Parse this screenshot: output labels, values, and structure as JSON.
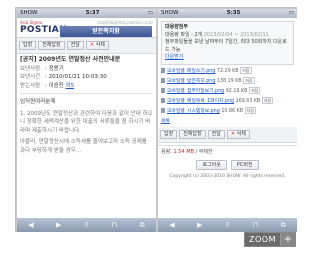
{
  "left": {
    "status": {
      "carrier": "SHOW",
      "time": "5:37"
    },
    "header": {
      "logo_small": "Asia Sigma",
      "logo_main": "POSTIAN",
      "email": "shom56@mbs.postian.co.kr",
      "title": "받은쪽지함"
    },
    "buttons": [
      "답장",
      "전체답장",
      "전달",
      "삭제"
    ],
    "message": {
      "subject": "[공지] 2009년도 연말정산 사전안내문",
      "from_label": "보낸사람",
      "from": "정용기",
      "date_label": "보낸시간",
      "date": "2010/01/21 10:03:30",
      "to_label": "받는사람",
      "to_prefix": "이승진",
      "to_link": "외5"
    },
    "body": [
      "임직원여러분께",
      "1. 2009년도 연말정산과 관련하여 다음과 같이 안내 하오니 정확한 세액계산을 위한 대출의 서류들을 첨 하시기 바라며 제출하시기 바랍니다.",
      "아울러, 연말정산시에 소득세를 줄여보고자 소득 공제를 과다 부당하게 받을 경우..."
    ]
  },
  "right": {
    "status": {
      "carrier": "SHOW",
      "time": "5:35"
    },
    "attach": {
      "title": "대용량첨부",
      "meta": "대용량 파일 : 2개",
      "date": "2013/02/04 ~ 2013/02/11",
      "note": "첨부파일들을 보낸 날짜부터 7일간, 최대 50회까지 다운로드 가능",
      "link_text": "다운받기"
    },
    "files": [
      {
        "name": "모바일웹_메일쓰기.png",
        "size": "72.29 KB"
      },
      {
        "name": "모바일웹_받은쪽지.png",
        "size": "138.19 KB"
      },
      {
        "name": "모바일웹_첨부파일보기.png",
        "size": "92.19 KB"
      },
      {
        "name": "모바일웹_메일목록_1페이지.png",
        "size": "169.65 KB"
      },
      {
        "name": "모바일웹_시스템정보.png",
        "size": "10.86 KB"
      }
    ],
    "file_view_label": "저장",
    "bottom_link": "목록",
    "buttons": [
      "답장",
      "전체답장",
      "전달",
      "삭제"
    ],
    "footer": {
      "usage_label": "용량",
      "usage": "1.54 MB",
      "quota": "무제한"
    },
    "login_buttons": [
      "로그아웃",
      "PC버전"
    ],
    "copyright": "Copyright (c) 2003-2010 SHOW. All rights reserved."
  },
  "zoom": {
    "label": "ZOOM",
    "plus": "+"
  },
  "toolbar_icons": [
    "back-arrow",
    "forward-arrow",
    "share",
    "bookmarks",
    "tabs"
  ]
}
